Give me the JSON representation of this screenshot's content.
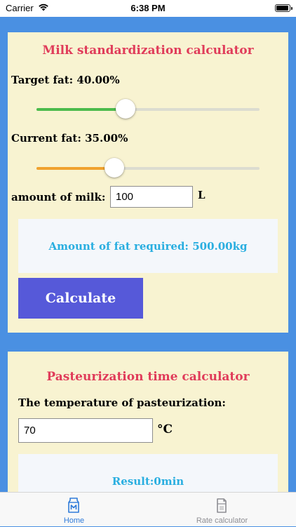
{
  "status_bar": {
    "carrier": "Carrier",
    "time": "6:38 PM"
  },
  "milk_card": {
    "title": "Milk standardization calculator",
    "target_fat_label": "Target fat: 40.00%",
    "target_fat_slider": {
      "value_fraction": 0.4,
      "color": "#4cbb4c"
    },
    "current_fat_label": "Current fat: 35.00%",
    "current_fat_slider": {
      "value_fraction": 0.35,
      "color": "#f0a22e"
    },
    "milk_amount_label": "amount of milk:",
    "milk_amount_value": "100",
    "milk_unit": "L",
    "result_text": "Amount of fat required: 500.00kg",
    "calculate_label": "Calculate"
  },
  "pasteurization_card": {
    "title": "Pasteurization time calculator",
    "temperature_label": "The temperature of pasteurization:",
    "temperature_value": "70",
    "temperature_unit": "°C",
    "result_text": "Result:0min"
  },
  "tab_bar": {
    "tabs": [
      {
        "label": "Home",
        "icon": "milk-carton-icon",
        "active": true,
        "color": "#2f7bd9"
      },
      {
        "label": "Rate calculator",
        "icon": "milk-box-icon",
        "active": false,
        "color": "#8e8e93"
      }
    ]
  },
  "colors": {
    "background": "#4a90e2",
    "card": "#f8f3d1",
    "title": "#e03c5a",
    "result_text": "#29aee0",
    "button": "#5659d9"
  }
}
